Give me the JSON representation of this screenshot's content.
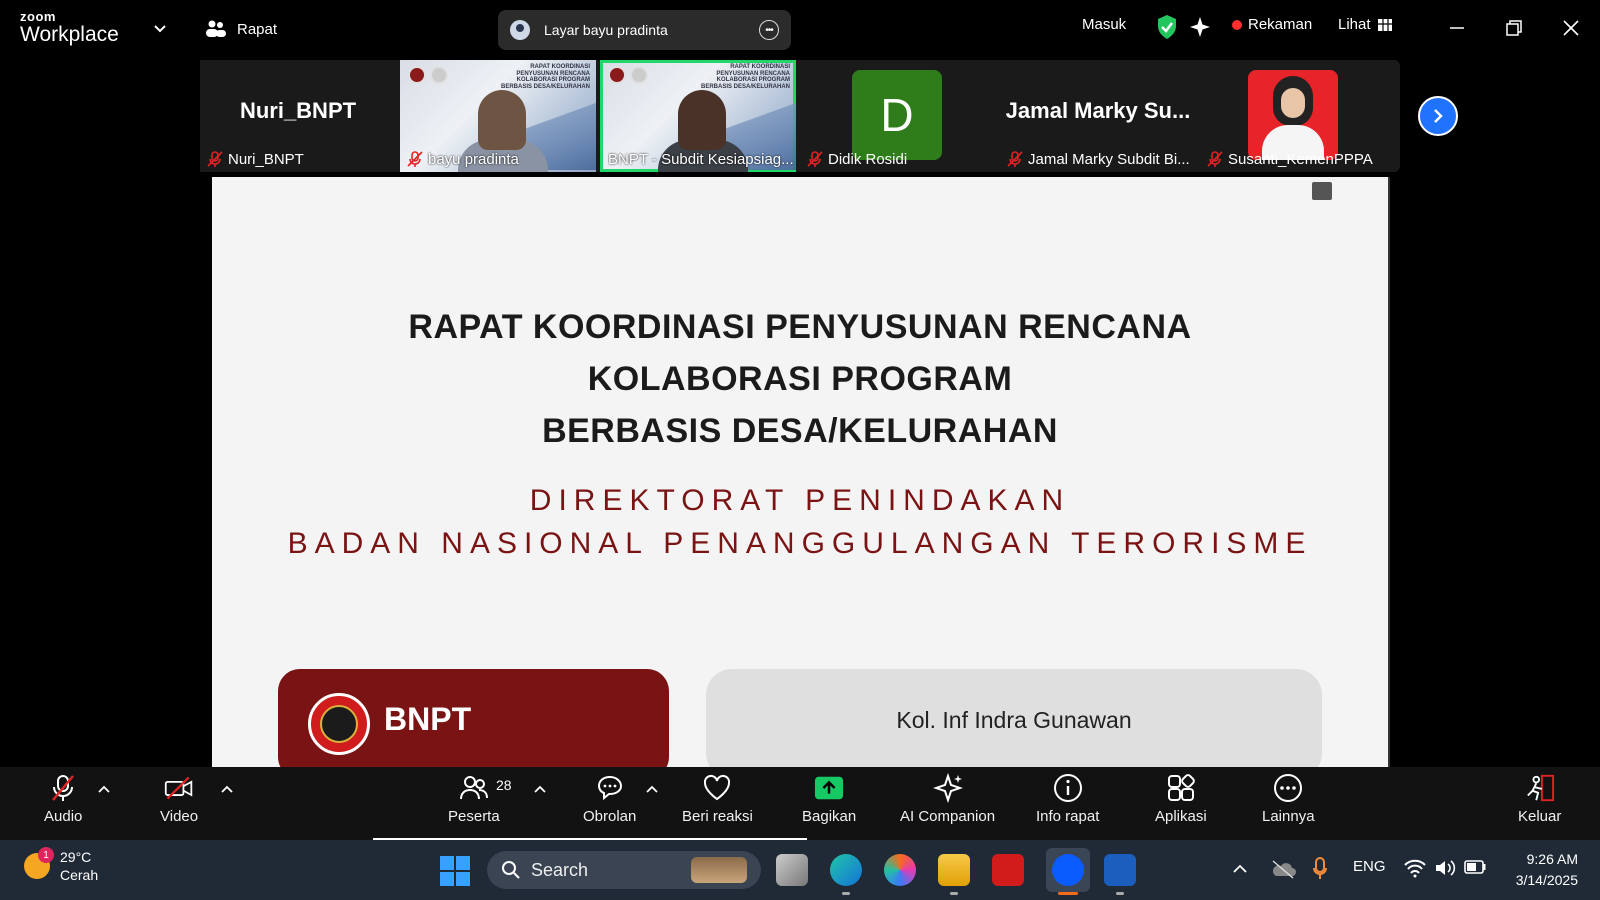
{
  "app": {
    "brand_top": "zoom",
    "brand_bottom": "Workplace",
    "meeting_label": "Rapat"
  },
  "screen_share": {
    "label": "Layar bayu pradinta"
  },
  "titlebar_right": {
    "signin": "Masuk",
    "recording": "Rekaman",
    "view": "Lihat"
  },
  "participants": [
    {
      "big_name": "Nuri_BNPT",
      "label": "Nuri_BNPT"
    },
    {
      "label": "bayu pradinta",
      "slide_mini": "RAPAT KOORDINASI PENYUSUNAN RENCANA KOLABORASI PROGRAM BERBASIS DESA/KELURAHAN"
    },
    {
      "label": "BNPT - Subdit Kesiapsiag...",
      "slide_mini": "RAPAT KOORDINASI PENYUSUNAN RENCANA KOLABORASI PROGRAM BERBASIS DESA/KELURAHAN"
    },
    {
      "avatar_letter": "D",
      "label": "Didik Rosidi"
    },
    {
      "big_name": "Jamal  Marky Su...",
      "label": "Jamal Marky Subdit Bi..."
    },
    {
      "label": "Susanti_KemenPPPA"
    }
  ],
  "slide": {
    "title_lines": [
      "RAPAT KOORDINASI PENYUSUNAN RENCANA",
      "KOLABORASI PROGRAM",
      "BERBASIS DESA/KELURAHAN"
    ],
    "sub_lines": [
      "DIREKTORAT PENINDAKAN",
      "BADAN NASIONAL PENANGGULANGAN TERORISME"
    ],
    "org": "BNPT",
    "presenter": "Kol. Inf Indra Gunawan"
  },
  "toolbar": {
    "audio": "Audio",
    "video": "Video",
    "participants": "Peserta",
    "participant_count": "28",
    "chat": "Obrolan",
    "react": "Beri reaksi",
    "share": "Bagikan",
    "ai": "AI Companion",
    "info": "Info rapat",
    "apps": "Aplikasi",
    "more": "Lainnya",
    "leave": "Keluar"
  },
  "taskbar": {
    "weather_temp": "29°C",
    "weather_desc": "Cerah",
    "weather_badge": "1",
    "search": "Search",
    "lang": "ENG",
    "time": "9:26 AM",
    "date": "3/14/2025"
  },
  "colors": {
    "active_tile": "#22d66a",
    "share": "#17c964",
    "slide_red": "#7a1414",
    "next": "#1f73ff"
  }
}
